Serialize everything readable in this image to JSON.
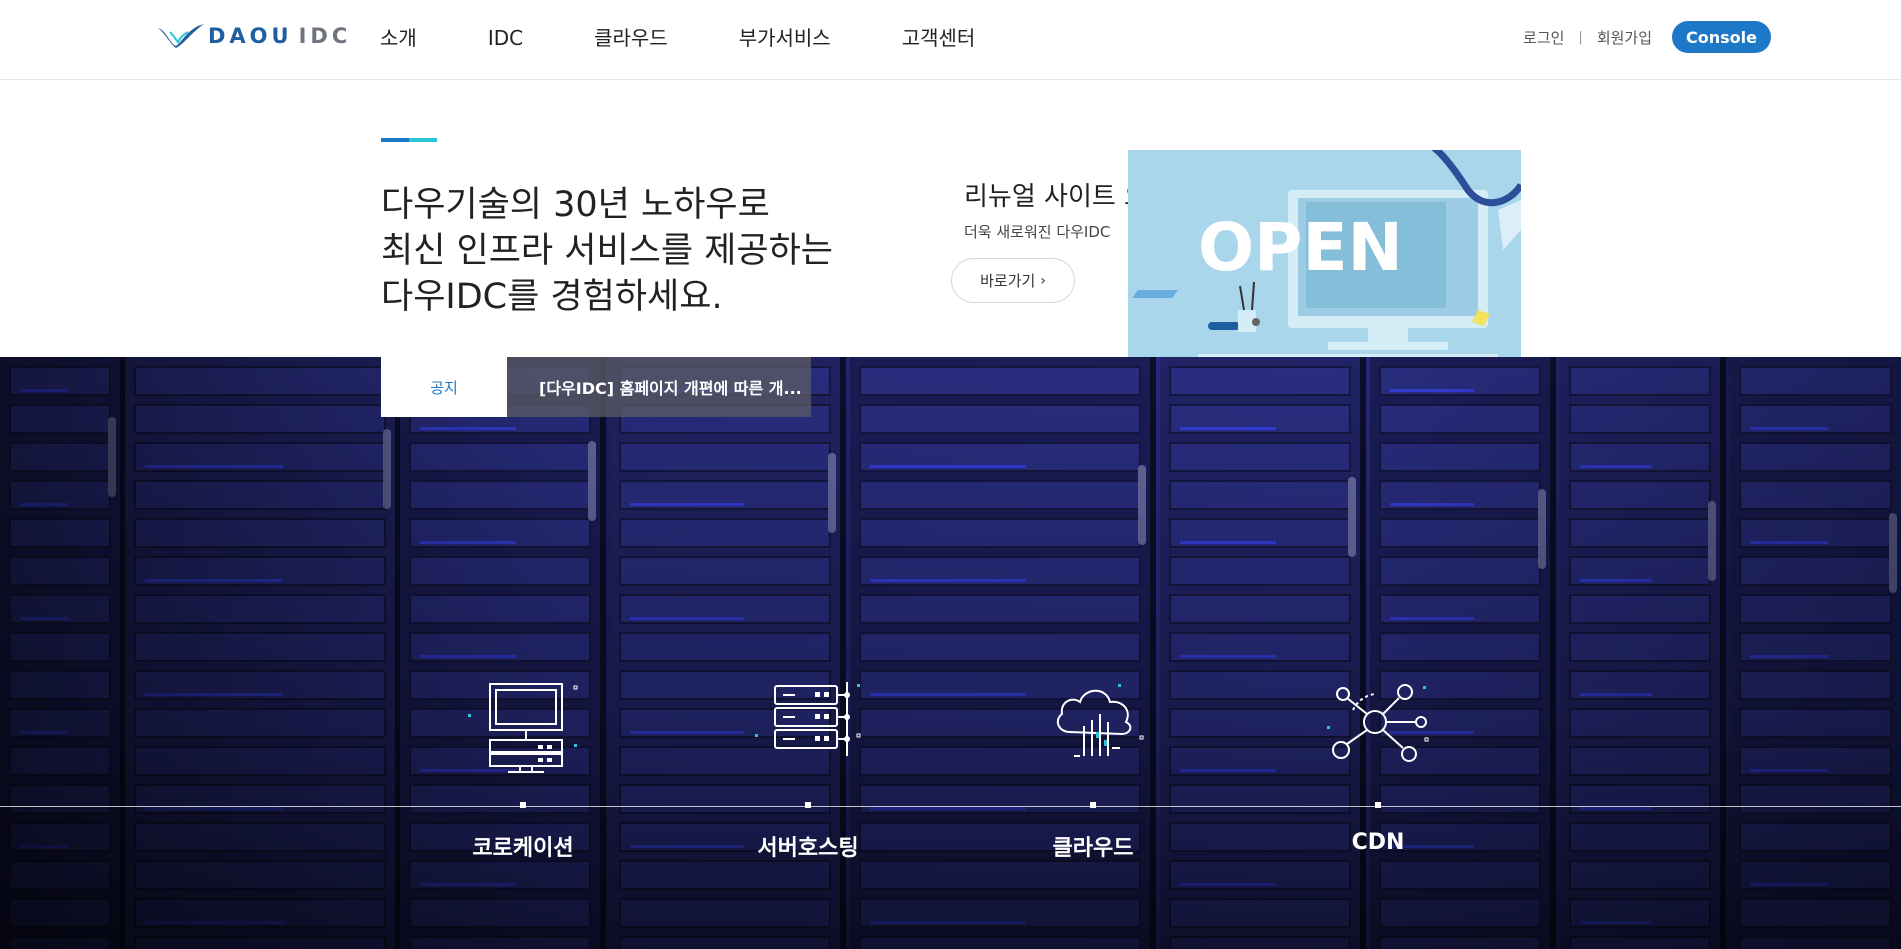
{
  "brand": {
    "logo_main": "DAOU",
    "logo_sub": "IDC",
    "colors": {
      "primary": "#1e78c8",
      "logo_blue": "#1f5ea0",
      "accent_cyan": "#2ec4d8"
    }
  },
  "nav": {
    "items": [
      {
        "label": "소개"
      },
      {
        "label": "IDC"
      },
      {
        "label": "클라우드"
      },
      {
        "label": "부가서비스"
      },
      {
        "label": "고객센터"
      }
    ]
  },
  "util": {
    "login": "로그인",
    "separator": "|",
    "signup": "회원가입",
    "console": "Console"
  },
  "intro": {
    "headline_lines": [
      "다우기술의 30년 노하우로",
      "최신 인프라 서비스를 제공하는",
      "다우IDC를 경험하세요."
    ]
  },
  "promo": {
    "title": "리뉴얼 사이트 오픈!",
    "subtitle": "더욱 새로워진 다우IDC",
    "button": "바로가기",
    "button_icon": "chevron-right-icon",
    "banner_text": "OPEN"
  },
  "notice": {
    "label": "공지",
    "text": "[다우IDC] 홈페이지 개편에 따른 개..."
  },
  "services": [
    {
      "label": "코로케이션",
      "icon": "computer-icon"
    },
    {
      "label": "서버호스팅",
      "icon": "server-rack-icon"
    },
    {
      "label": "클라우드",
      "icon": "cloud-icon"
    },
    {
      "label": "CDN",
      "icon": "network-nodes-icon"
    }
  ]
}
